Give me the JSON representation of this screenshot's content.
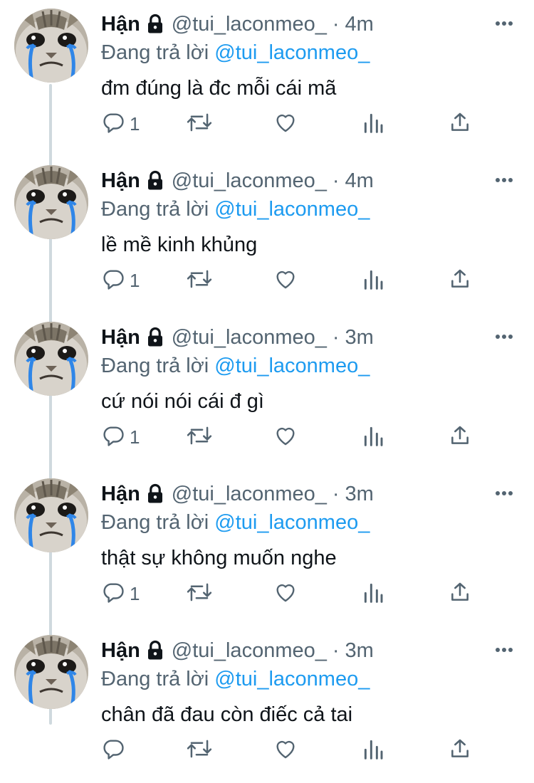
{
  "colors": {
    "text": "#0f1419",
    "muted": "#536471",
    "accent": "#1d9bf0",
    "thread": "#cfd9de"
  },
  "icons": {
    "lock": "lock-icon",
    "more": "more-icon",
    "reply": "reply-icon",
    "retweet": "retweet-icon",
    "like": "heart-icon",
    "stats": "stats-icon",
    "share": "share-icon"
  },
  "tweets": [
    {
      "name": "Hận",
      "handle": "@tui_laconmeo_",
      "separator": "·",
      "time": "4m",
      "reply_prefix": "Đang trả lời",
      "reply_to": "@tui_laconmeo_",
      "text": "đm đúng là đc mỗi cái mã",
      "reply_count": "1"
    },
    {
      "name": "Hận",
      "handle": "@tui_laconmeo_",
      "separator": "·",
      "time": "4m",
      "reply_prefix": "Đang trả lời",
      "reply_to": "@tui_laconmeo_",
      "text": "lề mề kinh khủng",
      "reply_count": "1"
    },
    {
      "name": "Hận",
      "handle": "@tui_laconmeo_",
      "separator": "·",
      "time": "3m",
      "reply_prefix": "Đang trả lời",
      "reply_to": "@tui_laconmeo_",
      "text": "cứ nói nói cái đ gì",
      "reply_count": "1"
    },
    {
      "name": "Hận",
      "handle": "@tui_laconmeo_",
      "separator": "·",
      "time": "3m",
      "reply_prefix": "Đang trả lời",
      "reply_to": "@tui_laconmeo_",
      "text": "thật sự không muốn nghe",
      "reply_count": "1"
    },
    {
      "name": "Hận",
      "handle": "@tui_laconmeo_",
      "separator": "·",
      "time": "3m",
      "reply_prefix": "Đang trả lời",
      "reply_to": "@tui_laconmeo_",
      "text": "chân đã đau còn điếc cả tai",
      "reply_count": ""
    }
  ]
}
